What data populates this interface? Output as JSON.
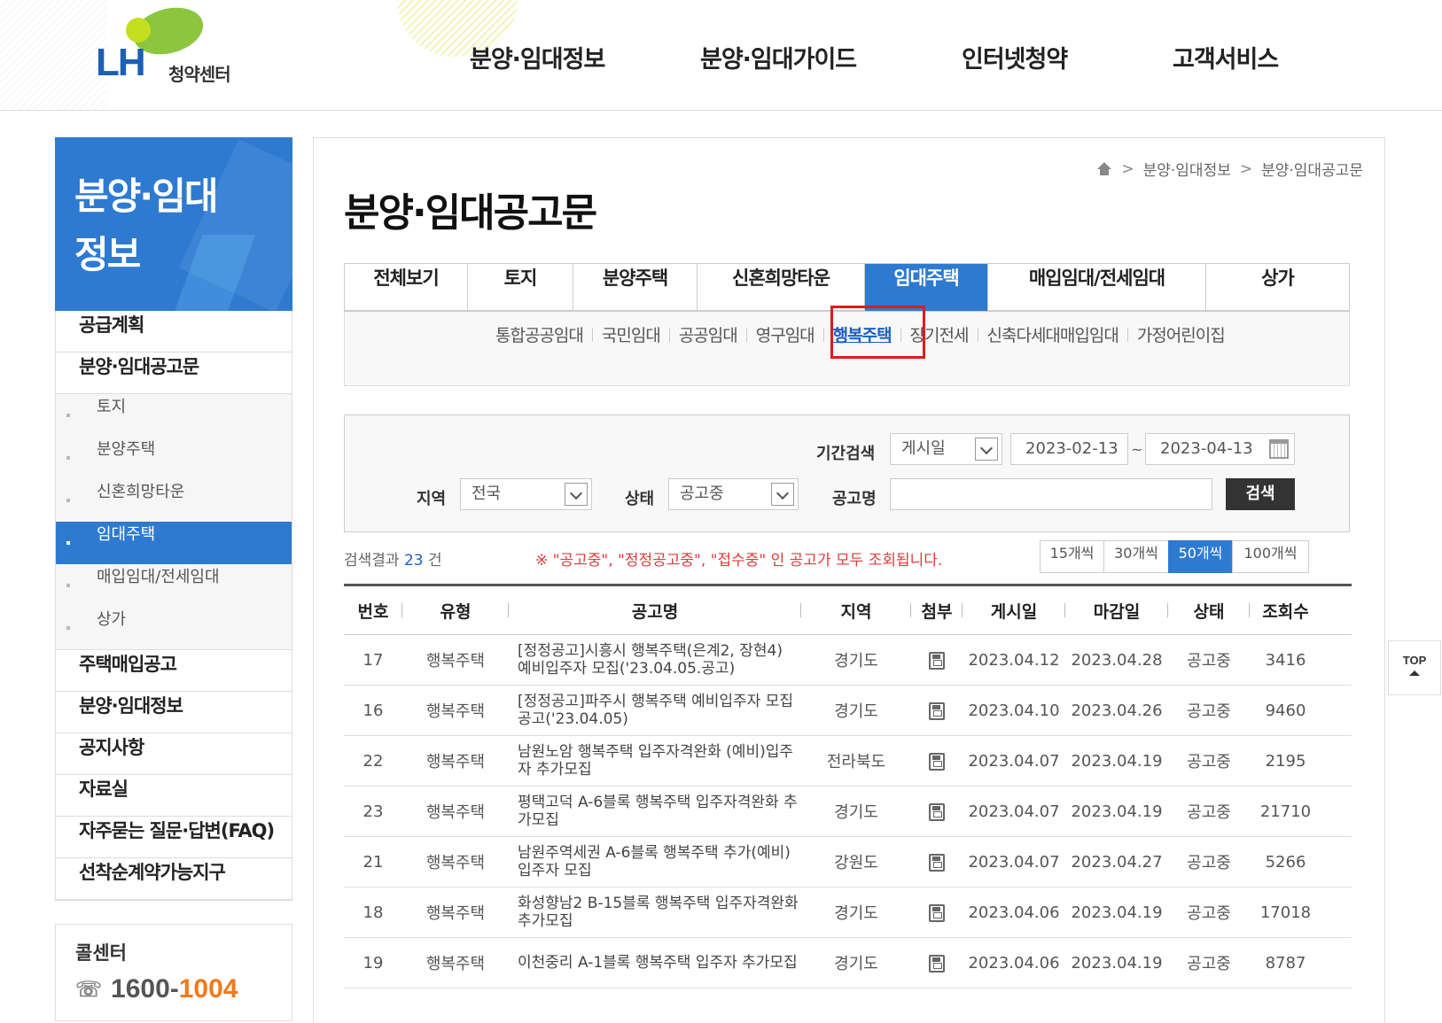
{
  "brand": {
    "logo_text": "LH",
    "logo_sub": "청약센터"
  },
  "gnb": [
    "분양·임대정보",
    "분양·임대가이드",
    "인터넷청약",
    "고객서비스"
  ],
  "sidebar": {
    "title_line1": "분양·임대",
    "title_line2": "정보",
    "items": [
      {
        "label": "공급계획"
      },
      {
        "label": "분양·임대공고문"
      }
    ],
    "subitems": [
      {
        "label": "토지"
      },
      {
        "label": "분양주택"
      },
      {
        "label": "신혼희망타운"
      },
      {
        "label": "임대주택",
        "active": true
      },
      {
        "label": "매입임대/전세임대"
      },
      {
        "label": "상가"
      }
    ],
    "items_after": [
      {
        "label": "주택매입공고"
      },
      {
        "label": "분양·임대정보"
      },
      {
        "label": "공지사항"
      },
      {
        "label": "자료실"
      },
      {
        "label": "자주묻는 질문·답변(FAQ)"
      },
      {
        "label": "선착순계약가능지구"
      }
    ],
    "callcenter": {
      "title": "콜센터",
      "num_a": "1600-",
      "num_b": "1004"
    }
  },
  "breadcrumb": {
    "level1": "분양·임대정보",
    "level2": "분양·임대공고문"
  },
  "page_title": "분양·임대공고문",
  "tabs": [
    "전체보기",
    "토지",
    "분양주택",
    "신혼희망타운",
    "임대주택",
    "매입임대/전세임대",
    "상가"
  ],
  "active_tab": "임대주택",
  "subtabs": [
    "통합공공임대",
    "국민임대",
    "공공임대",
    "영구임대",
    "행복주택",
    "장기전세",
    "신축다세대매입임대",
    "가정어린이집"
  ],
  "active_subtab": "행복주택",
  "search": {
    "period_label": "기간검색",
    "period_type": "게시일",
    "date_from": "2023-02-13",
    "tilde": "~",
    "date_to": "2023-04-13",
    "region_label": "지역",
    "region_value": "전국",
    "status_label": "상태",
    "status_value": "공고중",
    "name_label": "공고명",
    "name_value": "",
    "button": "검색"
  },
  "results": {
    "prefix": "검색결과",
    "count": "23",
    "suffix": "건",
    "notice": "※ \"공고중\", \"정정공고중\", \"접수중\" 인 공고가 모두 조회됩니다."
  },
  "per_page": [
    "15개씩",
    "30개씩",
    "50개씩",
    "100개씩"
  ],
  "per_page_active": "50개씩",
  "table": {
    "headers": [
      "번호",
      "유형",
      "공고명",
      "지역",
      "첨부",
      "게시일",
      "마감일",
      "상태",
      "조회수"
    ],
    "rows": [
      {
        "no": "17",
        "type": "행복주택",
        "title": "[정정공고]시흥시 행복주택(은계2, 장현4) 예비입주자 모집('23.04.05.공고)",
        "region": "경기도",
        "posted": "2023.04.12",
        "deadline": "2023.04.28",
        "status": "공고중",
        "views": "3416"
      },
      {
        "no": "16",
        "type": "행복주택",
        "title": "[정정공고]파주시 행복주택 예비입주자 모집공고('23.04.05)",
        "region": "경기도",
        "posted": "2023.04.10",
        "deadline": "2023.04.26",
        "status": "공고중",
        "views": "9460"
      },
      {
        "no": "22",
        "type": "행복주택",
        "title": "남원노암 행복주택 입주자격완화 (예비)입주자 추가모집",
        "region": "전라북도",
        "posted": "2023.04.07",
        "deadline": "2023.04.19",
        "status": "공고중",
        "views": "2195"
      },
      {
        "no": "23",
        "type": "행복주택",
        "title": "평택고덕 A-6블록 행복주택 입주자격완화 추가모집",
        "region": "경기도",
        "posted": "2023.04.07",
        "deadline": "2023.04.19",
        "status": "공고중",
        "views": "21710"
      },
      {
        "no": "21",
        "type": "행복주택",
        "title": "남원주역세권 A-6블록 행복주택 추가(예비)입주자 모집",
        "region": "강원도",
        "posted": "2023.04.07",
        "deadline": "2023.04.27",
        "status": "공고중",
        "views": "5266"
      },
      {
        "no": "18",
        "type": "행복주택",
        "title": "화성향남2 B-15블록 행복주택 입주자격완화 추가모집",
        "region": "경기도",
        "posted": "2023.04.06",
        "deadline": "2023.04.19",
        "status": "공고중",
        "views": "17018"
      },
      {
        "no": "19",
        "type": "행복주택",
        "title": "이천중리 A-1블록 행복주택 입주자 추가모집",
        "region": "경기도",
        "posted": "2023.04.06",
        "deadline": "2023.04.19",
        "status": "공고중",
        "views": "8787"
      }
    ]
  },
  "top_button": "TOP",
  "colors": {
    "primary": "#2e7ad1",
    "notice_red": "#e23a3a",
    "highlight": "#e01a1a",
    "accent_orange": "#f07a1a"
  }
}
